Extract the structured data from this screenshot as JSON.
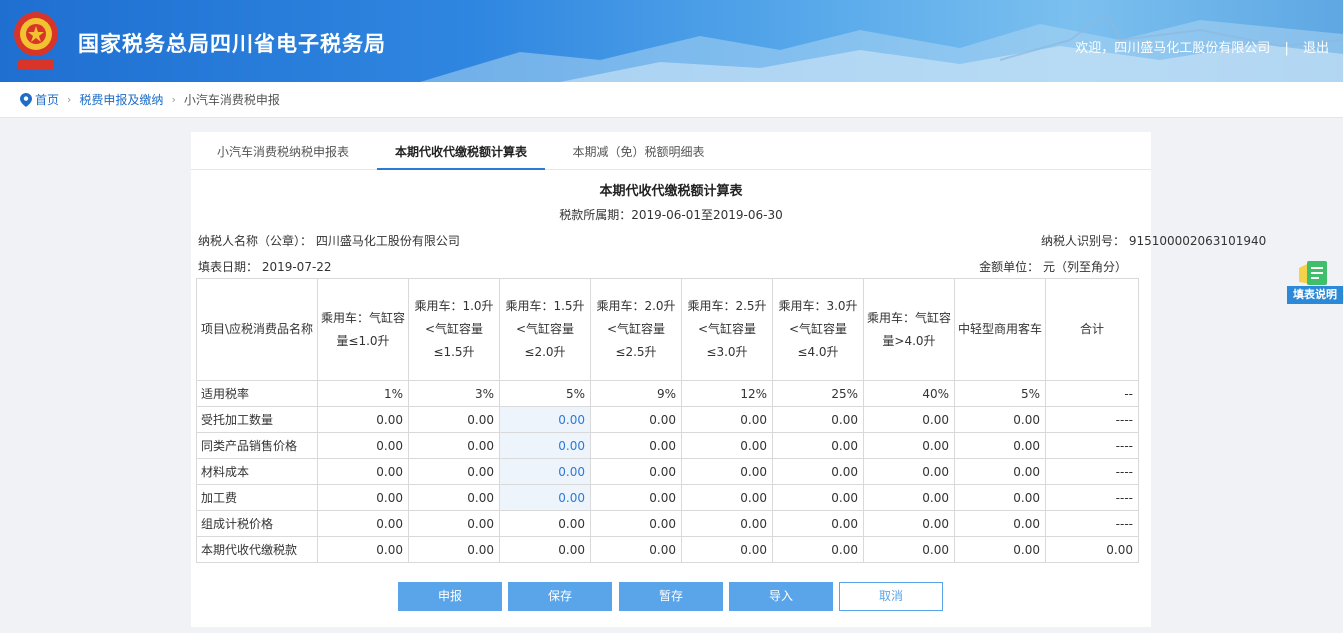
{
  "header": {
    "title": "国家税务总局四川省电子税务局",
    "welcome": "欢迎，四川盛马化工股份有限公司",
    "separator": "|",
    "logout": "退出"
  },
  "breadcrumb": {
    "home": "首页",
    "level1": "税费申报及缴纳",
    "current": "小汽车消费税申报",
    "arrow": "›"
  },
  "tabs": [
    {
      "label": "小汽车消费税纳税申报表",
      "active": false
    },
    {
      "label": "本期代收代缴税额计算表",
      "active": true
    },
    {
      "label": "本期减（免）税额明细表",
      "active": false
    }
  ],
  "form": {
    "title": "本期代收代缴税额计算表",
    "period": "税款所属期：2019-06-01至2019-06-30",
    "taxpayer_name": "纳税人名称（公章）：  四川盛马化工股份有限公司",
    "taxpayer_id": "纳税人识别号：  915100002063101940",
    "fill_date": "填表日期：  2019-07-22",
    "unit": "金额单位：  元（列至角分）"
  },
  "table": {
    "corner_header": "项目\\应税消费品名称",
    "columns": [
      "乘用车：气缸容量≤1.0升",
      "乘用车：1.0升<气缸容量≤1.5升",
      "乘用车：1.5升<气缸容量≤2.0升",
      "乘用车：2.0升<气缸容量≤2.5升",
      "乘用车：2.5升<气缸容量≤3.0升",
      "乘用车：3.0升<气缸容量≤4.0升",
      "乘用车：气缸容量>4.0升",
      "中轻型商用客车",
      "合计"
    ],
    "rows": [
      {
        "label": "适用税率",
        "values": [
          "1%",
          "3%",
          "5%",
          "9%",
          "12%",
          "25%",
          "40%",
          "5%",
          "--"
        ]
      },
      {
        "label": "受托加工数量",
        "values": [
          "0.00",
          "0.00",
          "0.00",
          "0.00",
          "0.00",
          "0.00",
          "0.00",
          "0.00",
          "----"
        ]
      },
      {
        "label": "同类产品销售价格",
        "values": [
          "0.00",
          "0.00",
          "0.00",
          "0.00",
          "0.00",
          "0.00",
          "0.00",
          "0.00",
          "----"
        ]
      },
      {
        "label": "材料成本",
        "values": [
          "0.00",
          "0.00",
          "0.00",
          "0.00",
          "0.00",
          "0.00",
          "0.00",
          "0.00",
          "----"
        ]
      },
      {
        "label": "加工费",
        "values": [
          "0.00",
          "0.00",
          "0.00",
          "0.00",
          "0.00",
          "0.00",
          "0.00",
          "0.00",
          "----"
        ]
      },
      {
        "label": "组成计税价格",
        "values": [
          "0.00",
          "0.00",
          "0.00",
          "0.00",
          "0.00",
          "0.00",
          "0.00",
          "0.00",
          "----"
        ]
      },
      {
        "label": "本期代收代缴税款",
        "values": [
          "0.00",
          "0.00",
          "0.00",
          "0.00",
          "0.00",
          "0.00",
          "0.00",
          "0.00",
          "0.00"
        ]
      }
    ]
  },
  "buttons": {
    "declare": "申报",
    "save": "保存",
    "temp_save": "暂存",
    "import": "导入",
    "cancel": "取消"
  },
  "help": {
    "label": "填表说明",
    "icon": "document-icon"
  },
  "colors": {
    "accent": "#2d7ad6",
    "button": "#5aa5ea",
    "editable_bg": "#eef4fc"
  }
}
